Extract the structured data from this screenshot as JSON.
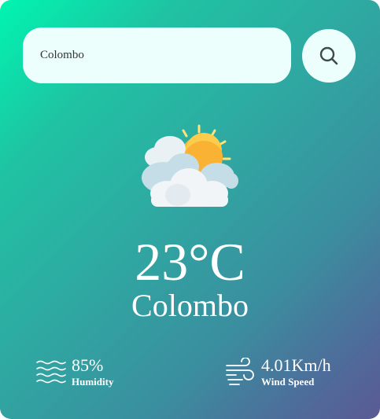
{
  "search": {
    "value": "Colombo",
    "button_icon": "search-icon"
  },
  "weather": {
    "icon": "cloudy-sun-icon",
    "temperature": "23°C",
    "city": "Colombo"
  },
  "stats": {
    "humidity": {
      "icon": "waves-icon",
      "value": "85%",
      "label": "Humidity"
    },
    "wind": {
      "icon": "wind-icon",
      "value": "4.01Km/h",
      "label": "Wind Speed"
    }
  },
  "colors": {
    "gradient_start": "#00f5b0",
    "gradient_end": "#5b5a94",
    "input_bg": "#ecfffc",
    "text": "#ffffff"
  }
}
